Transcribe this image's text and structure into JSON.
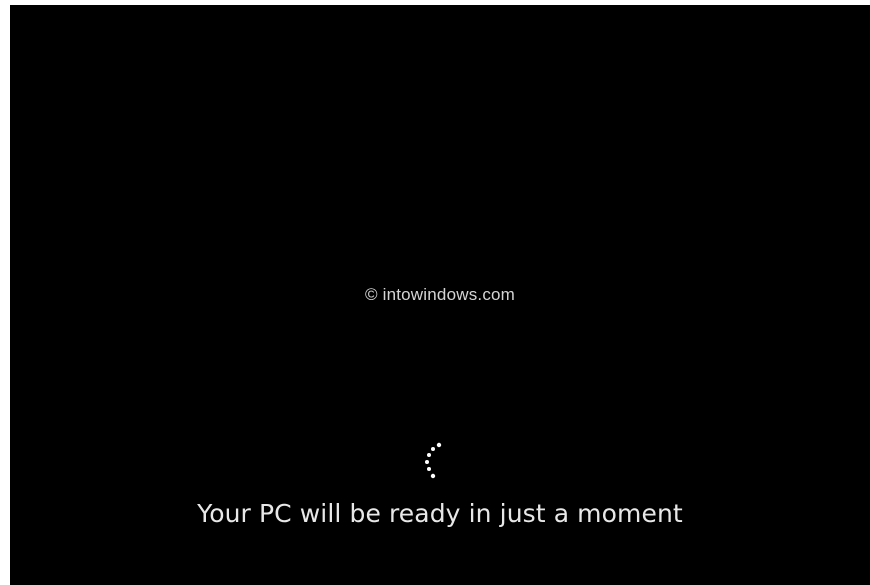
{
  "screen": {
    "background_color": "#000000",
    "watermark_text": "© intowindows.com",
    "status_message": "Your PC will be ready in just a moment",
    "spinner_icon": "loading-dots-icon",
    "text_color": "#ffffff"
  }
}
